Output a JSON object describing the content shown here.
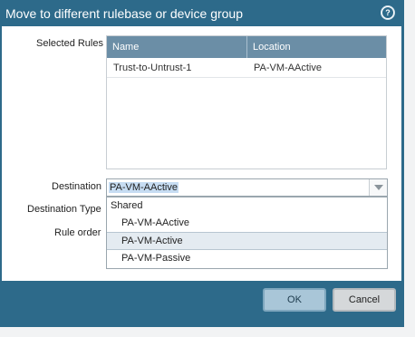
{
  "dialog": {
    "title": "Move to different rulebase or device group",
    "help_symbol": "?"
  },
  "form": {
    "selected_rules_label": "Selected Rules",
    "destination_label": "Destination",
    "destination_type_label": "Destination Type",
    "rule_order_label": "Rule order"
  },
  "table": {
    "columns": [
      "Name",
      "Location"
    ],
    "rows": [
      {
        "name": "Trust-to-Untrust-1",
        "location": "PA-VM-AActive"
      }
    ]
  },
  "destination": {
    "value": "PA-VM-AActive",
    "options": [
      "Shared",
      "PA-VM-AActive",
      "PA-VM-Active",
      "PA-VM-Passive"
    ],
    "highlighted_option": "PA-VM-Active"
  },
  "buttons": {
    "ok": "OK",
    "cancel": "Cancel"
  },
  "colors": {
    "title_bar": "#2d6a8a",
    "table_header": "#6b8ea6",
    "ok_button": "#a9c6d8"
  }
}
